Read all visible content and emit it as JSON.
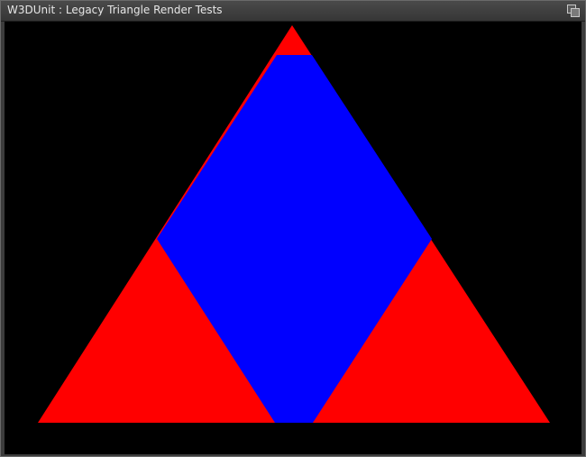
{
  "window": {
    "title": "W3DUnit : Legacy Triangle Render Tests",
    "title_button_icon": "restore-window-icon"
  },
  "viewport": {
    "background": "#000000",
    "colors": {
      "red": "#ff0000",
      "blue": "#0000ff"
    }
  }
}
